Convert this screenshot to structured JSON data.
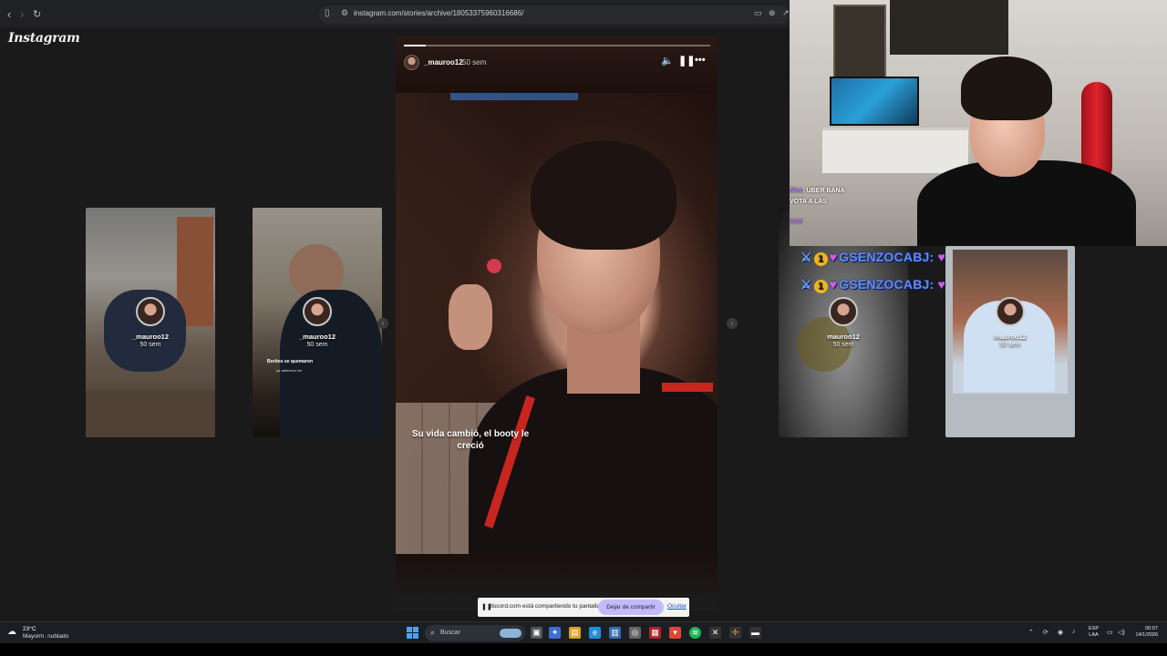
{
  "browser": {
    "url": "instagram.com/stories/archive/18053375960316686/"
  },
  "instagram": {
    "logo": "Instagram",
    "main_story": {
      "username": "_mauroo12",
      "time": "50 sem",
      "progress": 0.07,
      "overlay_text": "Su vida cambió, el booty le creció"
    },
    "side_stories": [
      {
        "username": "_mauroo12",
        "time": "50 sem"
      },
      {
        "username": "_mauroo12",
        "time": "50 sem",
        "caption": "Boritos se quemaron",
        "sub": "ya sabemos ver"
      },
      {
        "username": "mauroo12",
        "time": "50 sem"
      },
      {
        "username": "mauroo12",
        "time": "50 sem"
      }
    ]
  },
  "share_bar": {
    "text": "discord.com está compartiendo tu pantalla.",
    "stop_label": "Dejar de compartir",
    "hide_label": "Ocultar"
  },
  "stream": {
    "chat": [
      {
        "user": "ólos",
        "text": ": UBER BANA"
      },
      {
        "user": "",
        "text": "VOTA A LAS"
      },
      {
        "user": "oser",
        "text": ":"
      }
    ],
    "alert_name": "GSENZOCABJ:"
  },
  "taskbar": {
    "temp": "23°C",
    "condition": "Mayorm. nublado",
    "search": "Buscar",
    "lang1": "ESP",
    "lang2": "LAA",
    "time": "00:07",
    "date": "14/1/2026"
  }
}
